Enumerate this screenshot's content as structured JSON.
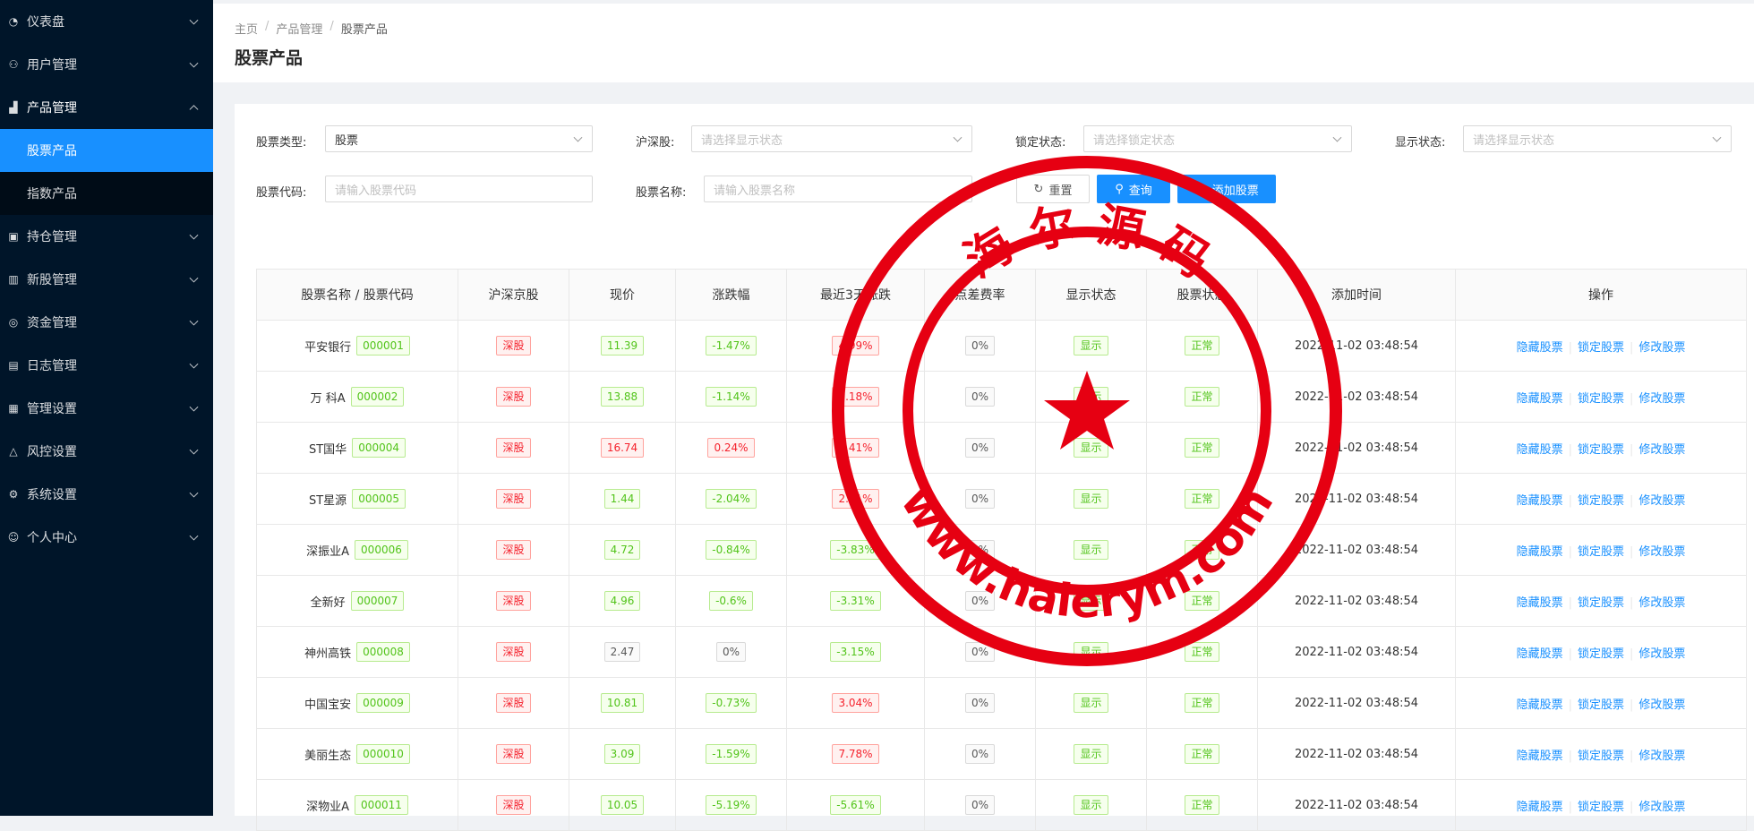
{
  "sidebar": {
    "items": [
      {
        "label": "仪表盘",
        "icon": "dashboard-icon"
      },
      {
        "label": "用户管理",
        "icon": "users-icon"
      },
      {
        "label": "产品管理",
        "icon": "chart-icon",
        "open": true,
        "children": [
          {
            "label": "股票产品",
            "active": true
          },
          {
            "label": "指数产品"
          }
        ]
      },
      {
        "label": "持仓管理",
        "icon": "position-icon"
      },
      {
        "label": "新股管理",
        "icon": "ipo-icon"
      },
      {
        "label": "资金管理",
        "icon": "money-icon"
      },
      {
        "label": "日志管理",
        "icon": "log-icon"
      },
      {
        "label": "管理设置",
        "icon": "admin-settings-icon"
      },
      {
        "label": "风控设置",
        "icon": "warning-icon"
      },
      {
        "label": "系统设置",
        "icon": "gear-icon"
      },
      {
        "label": "个人中心",
        "icon": "user-icon"
      }
    ]
  },
  "header": {
    "breadcrumb": [
      "主页",
      "产品管理",
      "股票产品"
    ],
    "title": "股票产品"
  },
  "filters": {
    "stock_type_label": "股票类型:",
    "stock_type_value": "股票",
    "exchange_label": "沪深股:",
    "exchange_placeholder": "请选择显示状态",
    "lock_label": "锁定状态:",
    "lock_placeholder": "请选择锁定状态",
    "display_label": "显示状态:",
    "display_placeholder": "请选择显示状态",
    "code_label": "股票代码:",
    "code_placeholder": "请输入股票代码",
    "name_label": "股票名称:",
    "name_placeholder": "请输入股票名称",
    "reset_label": "重置",
    "search_label": "查询",
    "add_label": "添加股票"
  },
  "table": {
    "columns": [
      "股票名称 / 股票代码",
      "沪深京股",
      "现价",
      "涨跌幅",
      "最近3天涨跌",
      "点差费率",
      "显示状态",
      "股票状态",
      "添加时间",
      "操作"
    ],
    "actions": [
      "隐藏股票",
      "锁定股票",
      "修改股票"
    ],
    "rows": [
      {
        "name": "平安银行",
        "code": "000001",
        "market": "深股",
        "price": "11.39",
        "price_color": "green",
        "change": "-1.47%",
        "change_color": "green",
        "change3": "4.99%",
        "change3_color": "red",
        "fee": "0%",
        "display": "显示",
        "status": "正常",
        "time": "2022-11-02 03:48:54"
      },
      {
        "name": "万 科A",
        "code": "000002",
        "market": "深股",
        "price": "13.88",
        "price_color": "green",
        "change": "-1.14%",
        "change_color": "green",
        "change3": "2.18%",
        "change3_color": "red",
        "fee": "0%",
        "display": "显示",
        "status": "正常",
        "time": "2022-11-02 03:48:54"
      },
      {
        "name": "ST国华",
        "code": "000004",
        "market": "深股",
        "price": "16.74",
        "price_color": "red",
        "change": "0.24%",
        "change_color": "red",
        "change3": "0.41%",
        "change3_color": "red",
        "fee": "0%",
        "display": "显示",
        "status": "正常",
        "time": "2022-11-02 03:48:54"
      },
      {
        "name": "ST星源",
        "code": "000005",
        "market": "深股",
        "price": "1.44",
        "price_color": "green",
        "change": "-2.04%",
        "change_color": "green",
        "change3": "2.31%",
        "change3_color": "red",
        "fee": "0%",
        "display": "显示",
        "status": "正常",
        "time": "2022-11-02 03:48:54"
      },
      {
        "name": "深振业A",
        "code": "000006",
        "market": "深股",
        "price": "4.72",
        "price_color": "green",
        "change": "-0.84%",
        "change_color": "green",
        "change3": "-3.83%",
        "change3_color": "green",
        "fee": "0%",
        "display": "显示",
        "status": "正常",
        "time": "2022-11-02 03:48:54"
      },
      {
        "name": "全新好",
        "code": "000007",
        "market": "深股",
        "price": "4.96",
        "price_color": "green",
        "change": "-0.6%",
        "change_color": "green",
        "change3": "-3.31%",
        "change3_color": "green",
        "fee": "0%",
        "display": "显示",
        "status": "正常",
        "time": "2022-11-02 03:48:54"
      },
      {
        "name": "神州高铁",
        "code": "000008",
        "market": "深股",
        "price": "2.47",
        "price_color": "gray",
        "change": "0%",
        "change_color": "gray",
        "change3": "-3.15%",
        "change3_color": "green",
        "fee": "0%",
        "display": "显示",
        "status": "正常",
        "time": "2022-11-02 03:48:54"
      },
      {
        "name": "中国宝安",
        "code": "000009",
        "market": "深股",
        "price": "10.81",
        "price_color": "green",
        "change": "-0.73%",
        "change_color": "green",
        "change3": "3.04%",
        "change3_color": "red",
        "fee": "0%",
        "display": "显示",
        "status": "正常",
        "time": "2022-11-02 03:48:54"
      },
      {
        "name": "美丽生态",
        "code": "000010",
        "market": "深股",
        "price": "3.09",
        "price_color": "green",
        "change": "-1.59%",
        "change_color": "green",
        "change3": "7.78%",
        "change3_color": "red",
        "fee": "0%",
        "display": "显示",
        "status": "正常",
        "time": "2022-11-02 03:48:54"
      },
      {
        "name": "深物业A",
        "code": "000011",
        "market": "深股",
        "price": "10.05",
        "price_color": "green",
        "change": "-5.19%",
        "change_color": "green",
        "change3": "-5.61%",
        "change3_color": "green",
        "fee": "0%",
        "display": "显示",
        "status": "正常",
        "time": "2022-11-02 03:48:54"
      }
    ]
  },
  "stamp": {
    "top_text": "海 尔 源 码",
    "bottom_text": "www.haierym.com",
    "color": "#e60012"
  }
}
